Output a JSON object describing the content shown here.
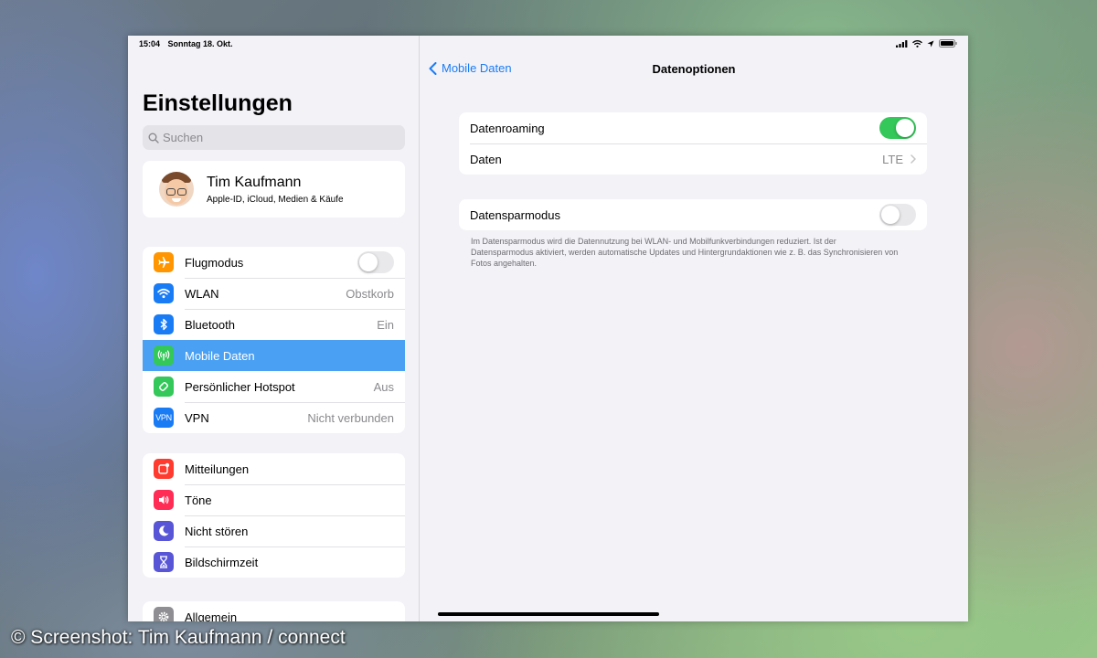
{
  "status_bar": {
    "time": "15:04",
    "date": "Sonntag 18. Okt."
  },
  "sidebar": {
    "title": "Einstellungen",
    "search_placeholder": "Suchen",
    "profile": {
      "name": "Tim Kaufmann",
      "subtitle": "Apple-ID, iCloud, Medien & Käufe"
    },
    "group1": [
      {
        "label": "Flugmodus",
        "icon": "airplane-icon",
        "color": "#ff9500",
        "toggle": false
      },
      {
        "label": "WLAN",
        "value": "Obstkorb",
        "icon": "wifi-icon",
        "color": "#1a7cf5"
      },
      {
        "label": "Bluetooth",
        "value": "Ein",
        "icon": "bluetooth-icon",
        "color": "#1a7cf5"
      },
      {
        "label": "Mobile Daten",
        "icon": "antenna-icon",
        "color": "#34c759",
        "selected": true
      },
      {
        "label": "Persönlicher Hotspot",
        "value": "Aus",
        "icon": "hotspot-icon",
        "color": "#34c759"
      },
      {
        "label": "VPN",
        "value": "Nicht verbunden",
        "icon": "vpn-icon",
        "icon_text": "VPN",
        "color": "#1a7cf5"
      }
    ],
    "group2": [
      {
        "label": "Mitteilungen",
        "icon": "notifications-icon",
        "color": "#ff3b30"
      },
      {
        "label": "Töne",
        "icon": "speaker-icon",
        "color": "#ff2d55"
      },
      {
        "label": "Nicht stören",
        "icon": "moon-icon",
        "color": "#5856d6"
      },
      {
        "label": "Bildschirmzeit",
        "icon": "hourglass-icon",
        "color": "#5856d6"
      }
    ],
    "group3": [
      {
        "label": "Allgemein",
        "icon": "gear-icon",
        "color": "#8e8e93"
      }
    ]
  },
  "detail": {
    "back_label": "Mobile Daten",
    "title": "Datenoptionen",
    "group1": [
      {
        "label": "Datenroaming",
        "toggle": true
      },
      {
        "label": "Daten",
        "value": "LTE"
      }
    ],
    "group2": [
      {
        "label": "Datensparmodus",
        "toggle": false
      }
    ],
    "footnote": "Im Datensparmodus wird die Datennutzung bei WLAN- und Mobilfunkverbindungen reduziert. Ist der Datensparmodus aktiviert, werden automatische Updates und Hintergrundaktionen wie z. B. das Synchronisieren von Fotos angehalten."
  },
  "watermark": "© Screenshot: Tim Kaufmann / connect",
  "colors": {
    "accent": "#1a7cf5",
    "selection": "#4aa0f3",
    "toggle_on": "#34c759"
  }
}
